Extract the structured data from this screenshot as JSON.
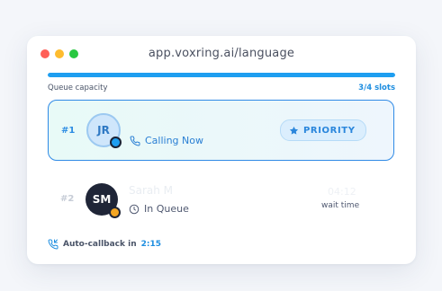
{
  "window": {
    "url": "app.voxring.ai/language"
  },
  "capacity": {
    "label": "Queue capacity",
    "value_text": "3/4 slots",
    "fill_fraction": 1.0
  },
  "queue": [
    {
      "rank": "#1",
      "initials": "JR",
      "status": "Calling Now",
      "badge": "PRIORITY"
    },
    {
      "rank": "#2",
      "initials": "SM",
      "name": "Sarah M",
      "status": "In Queue",
      "wait_value": "04:12",
      "wait_label": "wait time"
    }
  ],
  "callback": {
    "label": "Auto-callback in",
    "time": "2:15"
  },
  "colors": {
    "accent": "#1e9ef0",
    "priority_text": "#2a86dc",
    "status_busy": "#f4a623"
  },
  "icons": [
    "phone-icon",
    "star-icon",
    "clock-icon",
    "phone-callback-icon"
  ]
}
